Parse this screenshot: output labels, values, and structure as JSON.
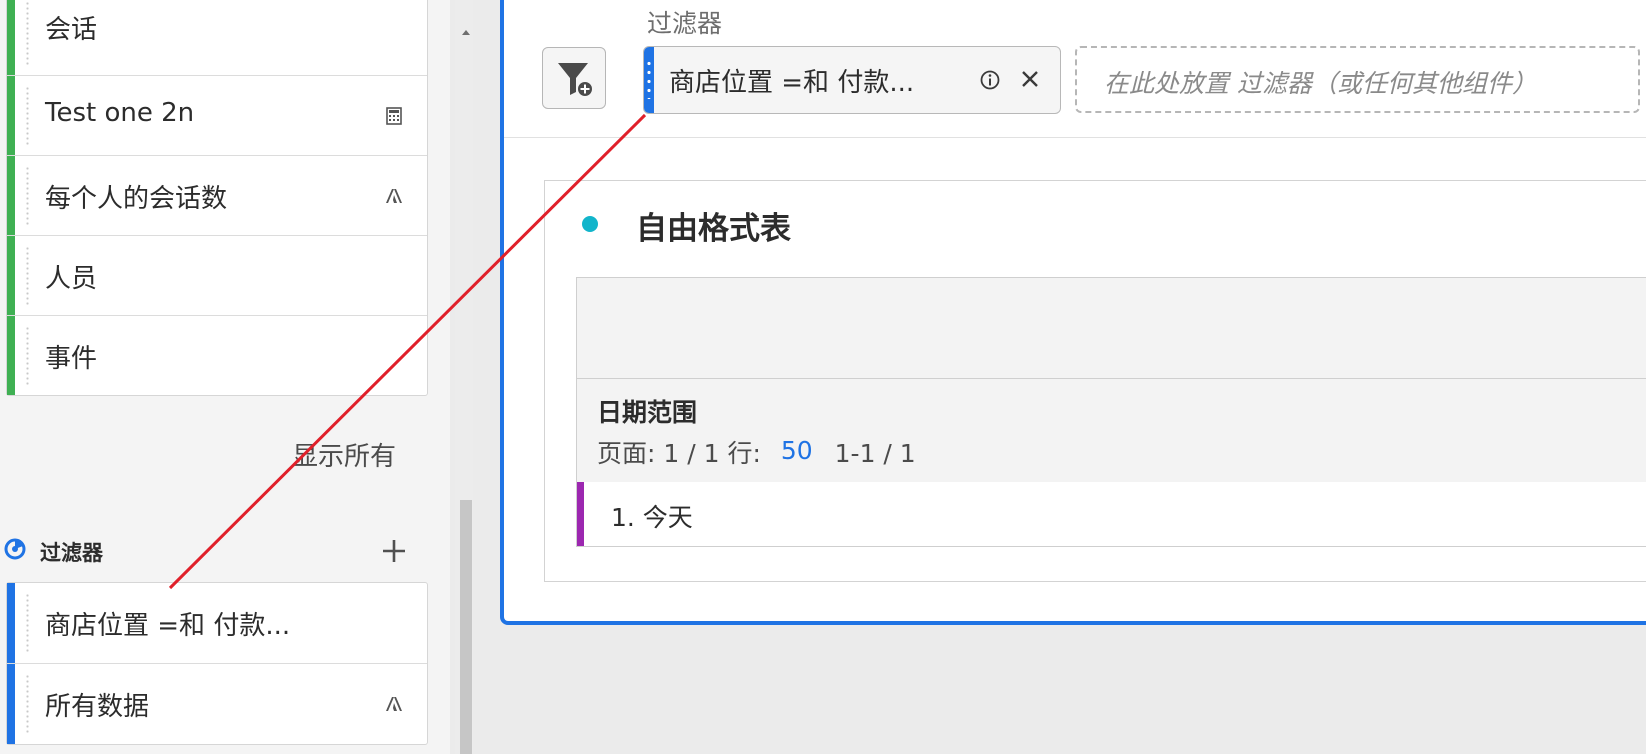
{
  "left_panel": {
    "metrics": [
      {
        "label": "会话",
        "icon": null,
        "color": "#3fb053"
      },
      {
        "label": "Test one 2n",
        "icon": "calculator-icon",
        "color": "#3fb053"
      },
      {
        "label": "每个人的会话数",
        "icon": "adobe-logo-icon",
        "color": "#3fb053"
      },
      {
        "label": "人员",
        "icon": null,
        "color": "#3fb053"
      },
      {
        "label": "事件",
        "icon": null,
        "color": "#3fb053"
      }
    ],
    "show_all_label": "显示所有",
    "filters_section": {
      "title": "过滤器",
      "icon": "filter-segment-icon",
      "add_icon": "plus-icon",
      "items": [
        {
          "label": "商店位置 =和 付款...",
          "icon": null,
          "color": "#1f73e4"
        },
        {
          "label": "所有数据",
          "icon": "adobe-logo-icon",
          "color": "#1f73e4"
        }
      ]
    }
  },
  "main_panel": {
    "filter_zone_title": "过滤器",
    "add_filter_icon": "filter-add-icon",
    "active_filter": {
      "label": "商店位置 =和 付款...",
      "info_icon": "info-icon",
      "close_icon": "close-icon"
    },
    "drop_zone_placeholder": "在此处放置 过滤器（或任何其他组件）",
    "visualization": {
      "title": "自由格式表",
      "dot_color": "#12b5cb",
      "dimension_title": "日期范围",
      "pagination": {
        "page_label": "页面:",
        "page_value": "1 / 1",
        "rows_label": "行:",
        "rows_value": "50",
        "range": "1-1 / 1"
      },
      "rows": [
        {
          "text": "1. 今天",
          "color": "#9c27b0"
        }
      ]
    }
  },
  "colors": {
    "accent": "#1f73e4",
    "drag_line": "#e0202a"
  }
}
